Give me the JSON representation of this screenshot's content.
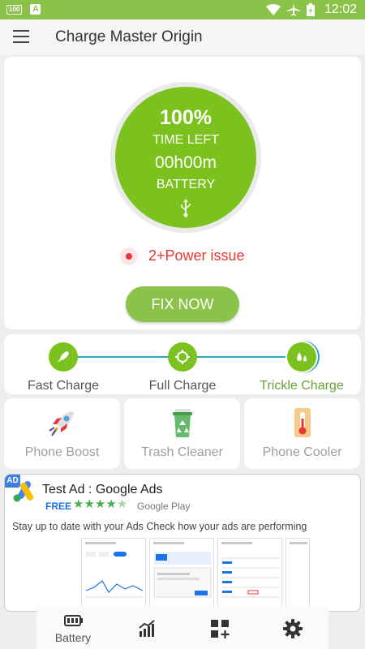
{
  "statusbar": {
    "badge": "100",
    "a_icon": "A",
    "time": "12:02"
  },
  "appbar": {
    "title": "Charge Master Origin"
  },
  "gauge": {
    "percent": "100%",
    "time_left_label": "TIME LEFT",
    "time": "00h00m",
    "battery_label": "BATTERY",
    "level": 1.0
  },
  "issue": {
    "text": "2+Power issue"
  },
  "fix_button": "FIX NOW",
  "steps": [
    {
      "label": "Fast Charge",
      "icon": "rocket-icon",
      "active": false
    },
    {
      "label": "Full Charge",
      "icon": "refresh-icon",
      "active": false
    },
    {
      "label": "Trickle Charge",
      "icon": "drops-icon",
      "active": true
    }
  ],
  "tools": [
    {
      "label": "Phone Boost",
      "icon": "rocket-boost-icon"
    },
    {
      "label": "Trash Cleaner",
      "icon": "recycle-bin-icon"
    },
    {
      "label": "Phone Cooler",
      "icon": "thermometer-icon"
    }
  ],
  "ad": {
    "badge": "AD",
    "title": "Test Ad : Google Ads",
    "price": "FREE",
    "rating": 4.5,
    "store": "Google Play",
    "description": "Stay up to date with your Ads Check how your ads are performing"
  },
  "bottom_nav": [
    {
      "label": "Battery",
      "icon": "battery-icon"
    },
    {
      "label": "",
      "icon": "chart-icon"
    },
    {
      "label": "",
      "icon": "apps-add-icon"
    },
    {
      "label": "",
      "icon": "settings-icon"
    }
  ],
  "colors": {
    "primary_green": "#8bc34a",
    "gauge_green": "#7cc21e",
    "issue_red": "#e53935",
    "line_teal": "#29a6b7",
    "active_step": "#689f38"
  }
}
